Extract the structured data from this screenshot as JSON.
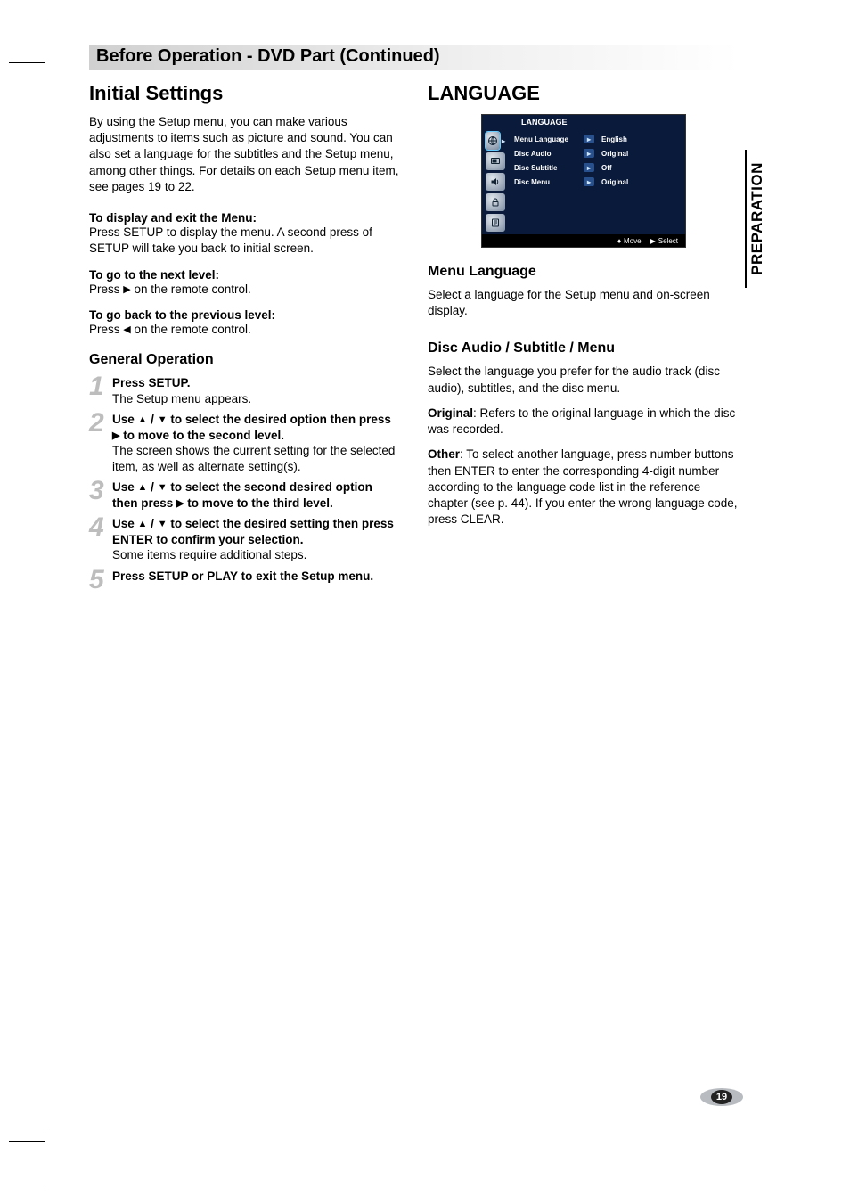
{
  "sectionBar": "Before Operation - DVD Part (Continued)",
  "sideTab": "PREPARATION",
  "pageNumber": "19",
  "left": {
    "heading": "Initial Settings",
    "intro": "By using the Setup menu, you can make various adjustments to items such as picture and sound. You can also set a language for the subtitles and the Setup menu, among other things. For details on each Setup menu item, see pages 19 to 22.",
    "displayExit": {
      "title": "To display and exit the Menu:",
      "body": "Press SETUP to display the menu. A second press of SETUP will take you back to initial screen."
    },
    "nextLevel": {
      "title": "To go to the next level:",
      "body_pre": "Press ",
      "body_post": " on the remote control."
    },
    "prevLevel": {
      "title": "To go back to the previous level:",
      "body_pre": "Press ",
      "body_post": " on the remote control."
    },
    "generalOp": "General Operation",
    "steps": {
      "s1_num": "1",
      "s1_a": "Press SETUP.",
      "s1_b": "The Setup menu appears.",
      "s2_num": "2",
      "s2_a_pre": "Use ",
      "s2_a_mid": " / ",
      "s2_a_post1": " to select the desired option then press ",
      "s2_a_post2": " to move to the second level.",
      "s2_b": "The screen shows the current setting for the selected item, as well as alternate setting(s).",
      "s3_num": "3",
      "s3_a_pre": "Use ",
      "s3_a_mid": " / ",
      "s3_a_post1": " to select the second desired option then press ",
      "s3_a_post2": " to move to the third level.",
      "s4_num": "4",
      "s4_a_pre": "Use ",
      "s4_a_mid": " / ",
      "s4_a_post": " to select the desired setting then press ENTER to confirm your selection.",
      "s4_b": "Some items require additional steps.",
      "s5_num": "5",
      "s5_a": "Press SETUP or PLAY to exit the Setup menu."
    }
  },
  "right": {
    "heading": "LANGUAGE",
    "osd": {
      "title": "LANGUAGE",
      "rows": [
        {
          "label": "Menu Language",
          "value": "English"
        },
        {
          "label": "Disc Audio",
          "value": "Original"
        },
        {
          "label": "Disc Subtitle",
          "value": "Off"
        },
        {
          "label": "Disc Menu",
          "value": "Original"
        }
      ],
      "footer": {
        "move": "Move",
        "select": "Select"
      }
    },
    "menuLang": {
      "title": "Menu Language",
      "body": "Select a language for the Setup menu and on-screen display."
    },
    "discASM": {
      "title": "Disc Audio / Subtitle / Menu",
      "p1": "Select the language you prefer for the audio track (disc audio), subtitles, and the disc menu.",
      "orig_label": "Original",
      "orig_body": ": Refers to the original language in which the disc was recorded.",
      "other_label": "Other",
      "other_body": ": To select another language, press number buttons then ENTER to enter the corresponding 4-digit number according to the language code list in the reference chapter (see p. 44). If you enter the wrong language code, press CLEAR."
    }
  }
}
